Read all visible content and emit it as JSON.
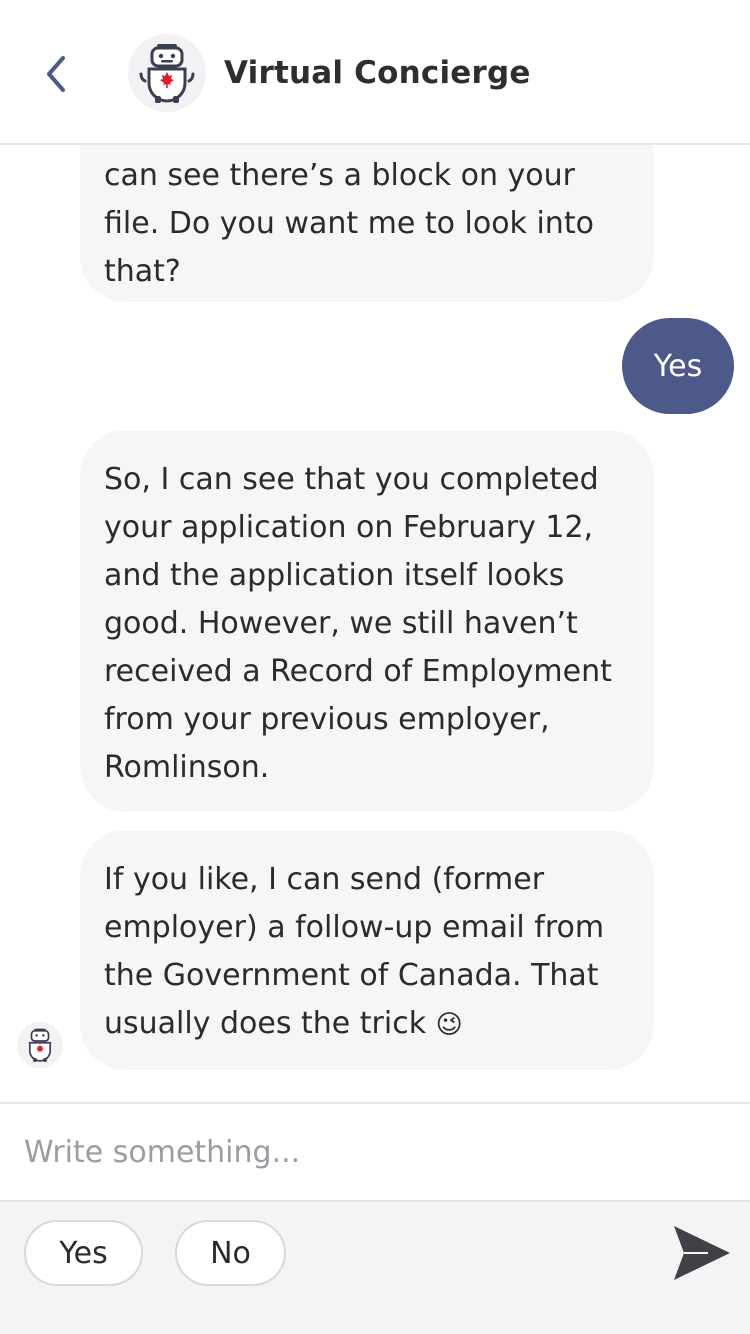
{
  "header": {
    "title": "Virtual Concierge",
    "back_icon": "chevron-left-icon",
    "avatar_icon": "robot-maple-leaf-icon"
  },
  "messages": [
    {
      "sender": "bot",
      "lines": [
        "can see there’s a block on your",
        "file. Do you want me to look into",
        "that?"
      ]
    },
    {
      "sender": "user",
      "text": "Yes"
    },
    {
      "sender": "bot",
      "lines": [
        "So, I can see that you completed",
        "your application on February 12,",
        "and the application itself looks",
        "good. However, we still haven’t",
        "received a Record of Employment",
        "from your previous employer,",
        "Romlinson."
      ]
    },
    {
      "sender": "bot",
      "lines": [
        "If you like, I can send (former",
        "employer) a follow-up email from",
        "the Government of Canada. That",
        "usually does the trick"
      ],
      "emoji": "😉"
    }
  ],
  "composer": {
    "placeholder": "Write something...",
    "value": ""
  },
  "quick_replies": [
    "Yes",
    "No"
  ],
  "send_icon": "send-arrow-icon",
  "colors": {
    "user_bubble": "#4d5989",
    "bot_bubble": "#f6f6f7",
    "accent": "#4d5989",
    "maple_leaf": "#d81f2a"
  }
}
